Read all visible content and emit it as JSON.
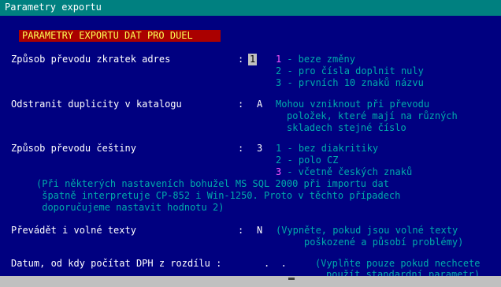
{
  "window": {
    "title": "Parametry exportu"
  },
  "header": "PARAMETRY EXPORTU DAT PRO DUEL",
  "rows": [
    {
      "label": "Způsob převodu zkratek adres",
      "sep": ":",
      "value": "1",
      "options": [
        {
          "num": "1",
          "text": " - beze změny"
        },
        {
          "num": "",
          "text": "2 - pro čísla doplnit nuly"
        },
        {
          "num": "",
          "text": "3 - prvních 10 znaků názvu"
        }
      ]
    },
    {
      "label": "Odstranit duplicity v katalogu",
      "sep": ":",
      "value": "A",
      "note": [
        "Mohou vzniknout při převodu",
        "položek, které mají na různých",
        "skladech stejné číslo"
      ]
    },
    {
      "label": "Způsob převodu češtiny",
      "sep": ":",
      "value": "3",
      "options": [
        {
          "num": "",
          "text": "1 - bez diakritiky"
        },
        {
          "num": "",
          "text": "2 - polo CZ"
        },
        {
          "num": "3",
          "text": " - včetně českých znaků"
        }
      ],
      "warning": [
        "(Při některých nastaveních bohužel MS SQL 2000 při importu dat",
        " špatně interpretuje CP-852 i Win-1250. Proto v těchto případech",
        " doporučujeme nastavit hodnotu 2)"
      ]
    },
    {
      "label": "Převádět i volné texty",
      "sep": ":",
      "value": "N",
      "note": [
        "(Vypněte, pokud jsou volné texty",
        "poškozené a působí problémy)"
      ]
    },
    {
      "label": "Datum, od kdy počítat DPH z rozdílu :",
      "value": ".  .",
      "note": [
        "(Vyplňte pouze pokud nechcete",
        "použít standardní parametr)"
      ]
    }
  ],
  "colors": {
    "background": "#000080",
    "titlebar": "#008080",
    "header_bg": "#aa0000",
    "header_fg": "#ffff55",
    "label": "#ffffff",
    "hint": "#00aaaa",
    "highlight": "#ff55ff"
  }
}
